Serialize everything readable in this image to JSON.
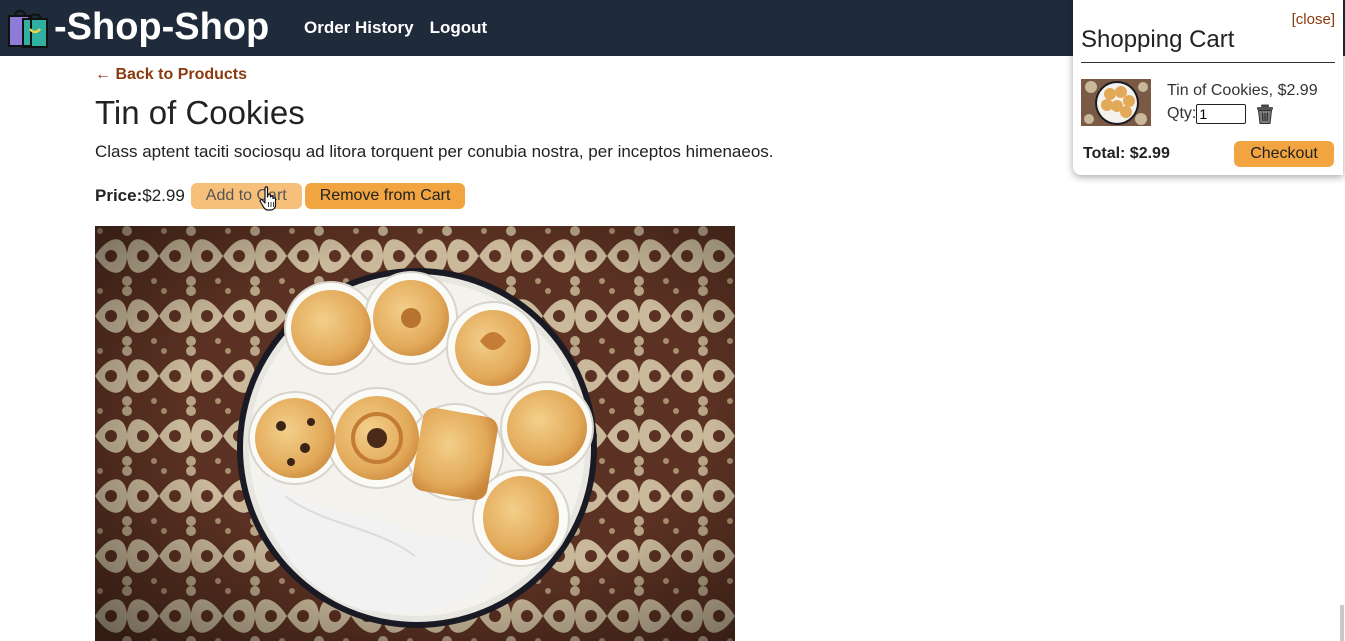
{
  "header": {
    "brand": "-Shop-Shop",
    "nav": [
      {
        "label": "Order History"
      },
      {
        "label": "Logout"
      }
    ],
    "background_color": "#1f2a3a"
  },
  "product": {
    "back_link": "← Back to Products",
    "title": "Tin of Cookies",
    "description": "Class aptent taciti sociosqu ad litora torquent per conubia nostra, per inceptos himenaeos.",
    "price_label": "Price:",
    "price_value": "$2.99",
    "add_button": "Add to Cart",
    "remove_button": "Remove from Cart",
    "image_icon": "cookie-tin-photo"
  },
  "cart": {
    "close_label": "[close]",
    "title": "Shopping Cart",
    "items": [
      {
        "name": "Tin of Cookies, $2.99",
        "qty_label": "Qty:",
        "qty_value": "1"
      }
    ],
    "total": "Total: $2.99",
    "checkout_button": "Checkout"
  },
  "colors": {
    "accent": "#f2a441",
    "link": "#8b3a0e"
  }
}
